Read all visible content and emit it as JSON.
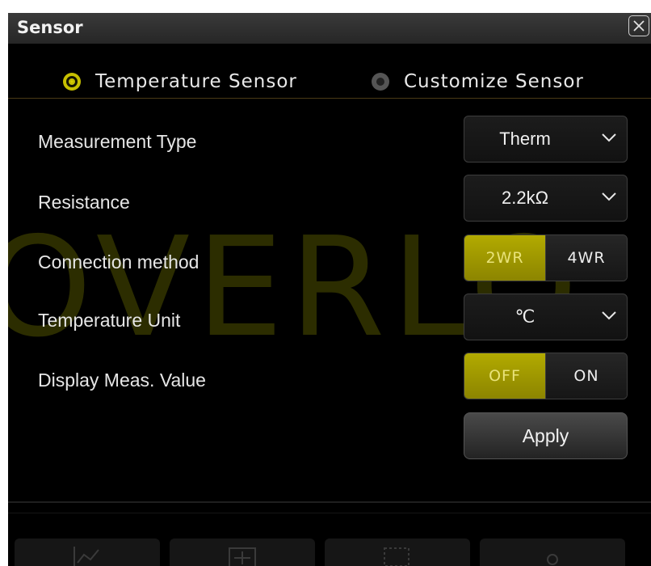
{
  "dialog": {
    "title": "Sensor",
    "watermark": "OVERLO"
  },
  "sensor_type": {
    "options": [
      {
        "label": "Temperature Sensor",
        "selected": true
      },
      {
        "label": "Customize Sensor",
        "selected": false
      }
    ]
  },
  "settings": {
    "measurement_type": {
      "label": "Measurement Type",
      "value": "Therm"
    },
    "resistance": {
      "label": "Resistance",
      "value": "2.2kΩ"
    },
    "connection_method": {
      "label": "Connection method",
      "options": [
        "2WR",
        "4WR"
      ],
      "selected": "2WR"
    },
    "temperature_unit": {
      "label": "Temperature Unit",
      "value": "℃"
    },
    "display_meas_value": {
      "label": "Display Meas. Value",
      "options": [
        "OFF",
        "ON"
      ],
      "selected": "OFF"
    }
  },
  "apply_label": "Apply",
  "colors": {
    "accent": "#b2aa00",
    "background": "#000000",
    "titlebar": "#2e2e2e"
  },
  "icons": {
    "close": "close-icon",
    "chevron": "chevron-down-icon",
    "toolbar": [
      "chart-icon",
      "plus-minus-icon",
      "dashed-box-icon",
      "tool-icon"
    ]
  }
}
